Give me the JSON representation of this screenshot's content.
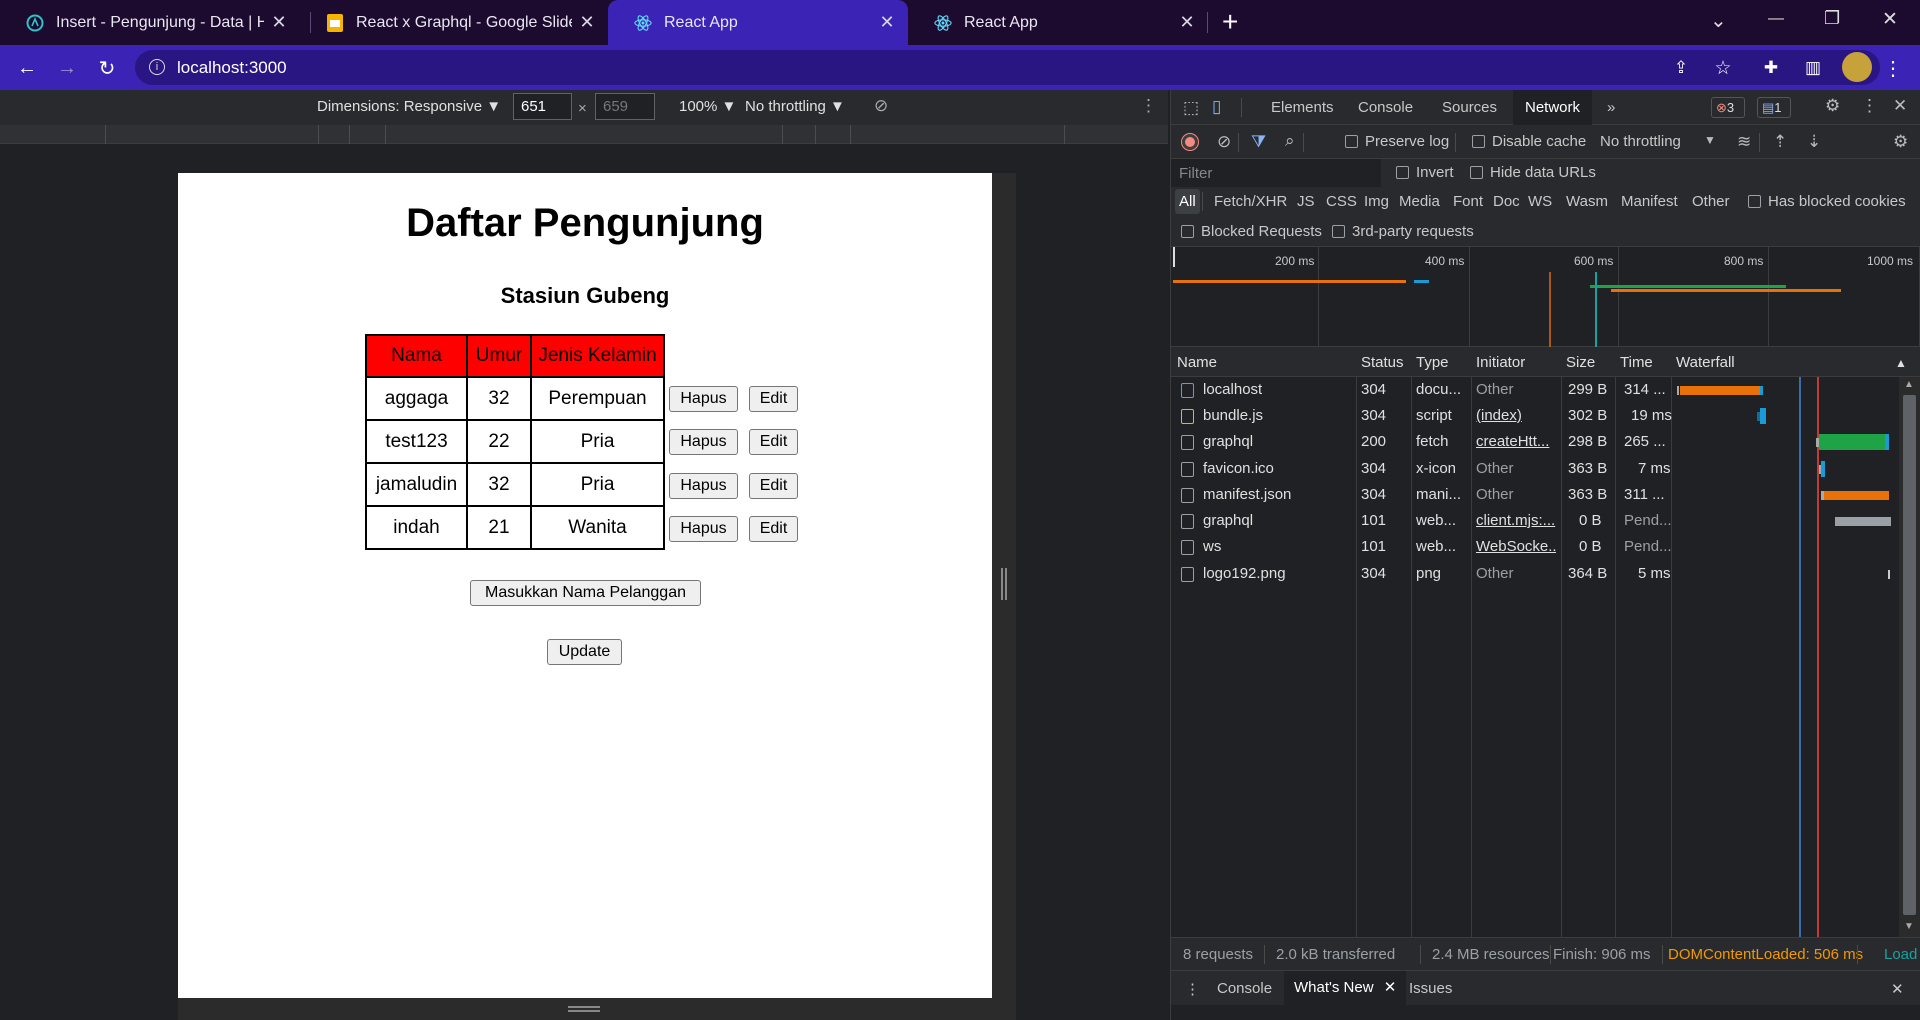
{
  "browser": {
    "tabs": [
      {
        "title": "Insert - Pengunjung - Data | Hasura",
        "favicon": "hasura-icon",
        "active": false
      },
      {
        "title": "React x Graphql - Google Slides",
        "favicon": "slides-icon",
        "active": false
      },
      {
        "title": "React App",
        "favicon": "react-icon",
        "active": true
      },
      {
        "title": "React App",
        "favicon": "react-icon",
        "active": false
      }
    ],
    "new_tab": "+",
    "url": "localhost:3000",
    "window_controls": {
      "dropdown": "⌄",
      "minimize": "—",
      "restore": "❐",
      "close": "✕"
    }
  },
  "device_toolbar": {
    "dimensions_label": "Dimensions: Responsive ▼",
    "width": "651",
    "height": "659",
    "zoom": "100% ▼",
    "throttling": "No throttling ▼"
  },
  "page": {
    "title": "Daftar Pengunjung",
    "subtitle": "Stasiun Gubeng",
    "table": {
      "headers": [
        "Nama",
        "Umur",
        "Jenis Kelamin"
      ],
      "rows": [
        {
          "nama": "aggaga",
          "umur": "32",
          "jenis_kelamin": "Perempuan"
        },
        {
          "nama": "test123",
          "umur": "22",
          "jenis_kelamin": "Pria"
        },
        {
          "nama": "jamaludin",
          "umur": "32",
          "jenis_kelamin": "Pria"
        },
        {
          "nama": "indah",
          "umur": "21",
          "jenis_kelamin": "Wanita"
        }
      ],
      "delete_label": "Hapus",
      "edit_label": "Edit"
    },
    "add_button": "Masukkan Nama Pelanggan",
    "update_button": "Update"
  },
  "devtools": {
    "tabs": [
      "Elements",
      "Console",
      "Sources",
      "Network"
    ],
    "active_tab": "Network",
    "more": "»",
    "error_count": "3",
    "message_count": "1",
    "toolbar": {
      "preserve_log": "Preserve log",
      "disable_cache": "Disable cache",
      "throttling": "No throttling"
    },
    "filter_placeholder": "Filter",
    "invert": "Invert",
    "hide_data_urls": "Hide data URLs",
    "type_filters": [
      "All",
      "Fetch/XHR",
      "JS",
      "CSS",
      "Img",
      "Media",
      "Font",
      "Doc",
      "WS",
      "Wasm",
      "Manifest",
      "Other"
    ],
    "has_blocked_cookies": "Has blocked cookies",
    "blocked_requests": "Blocked Requests",
    "third_party": "3rd-party requests",
    "timeline_labels": [
      "200 ms",
      "400 ms",
      "600 ms",
      "800 ms",
      "1000 ms"
    ],
    "columns": [
      "Name",
      "Status",
      "Type",
      "Initiator",
      "Size",
      "Time",
      "Waterfall"
    ],
    "requests": [
      {
        "name": "localhost",
        "status": "304",
        "type": "docu...",
        "initiator": "Other",
        "size": "299 B",
        "time": "314 ...",
        "kind": "doc"
      },
      {
        "name": "bundle.js",
        "status": "304",
        "type": "script",
        "initiator": "(index)",
        "size": "302 B",
        "time": "19 ms",
        "kind": "js"
      },
      {
        "name": "graphql",
        "status": "200",
        "type": "fetch",
        "initiator": "createHtt...",
        "size": "298 B",
        "time": "265 ...",
        "kind": "other"
      },
      {
        "name": "favicon.ico",
        "status": "304",
        "type": "x-icon",
        "initiator": "Other",
        "size": "363 B",
        "time": "7 ms",
        "kind": "other"
      },
      {
        "name": "manifest.json",
        "status": "304",
        "type": "mani...",
        "initiator": "Other",
        "size": "363 B",
        "time": "311 ...",
        "kind": "other"
      },
      {
        "name": "graphql",
        "status": "101",
        "type": "web...",
        "initiator": "client.mjs:...",
        "size": "0 B",
        "time": "Pend...",
        "kind": "other"
      },
      {
        "name": "ws",
        "status": "101",
        "type": "web...",
        "initiator": "WebSocke...",
        "size": "0 B",
        "time": "Pend...",
        "kind": "other"
      },
      {
        "name": "logo192.png",
        "status": "304",
        "type": "png",
        "initiator": "Other",
        "size": "364 B",
        "time": "5 ms",
        "kind": "other"
      }
    ],
    "status": {
      "requests": "8 requests",
      "transferred": "2.0 kB transferred",
      "resources": "2.4 MB resources",
      "finish": "Finish: 906 ms",
      "dcl": "DOMContentLoaded: 506 ms",
      "load": "Load"
    },
    "drawer_tabs": [
      "Console",
      "What's New",
      "Issues"
    ],
    "colors": {
      "dcl": "#4a90e2",
      "load": "#e8453c",
      "waiting": "#1ea446",
      "download": "#e8710a"
    }
  }
}
